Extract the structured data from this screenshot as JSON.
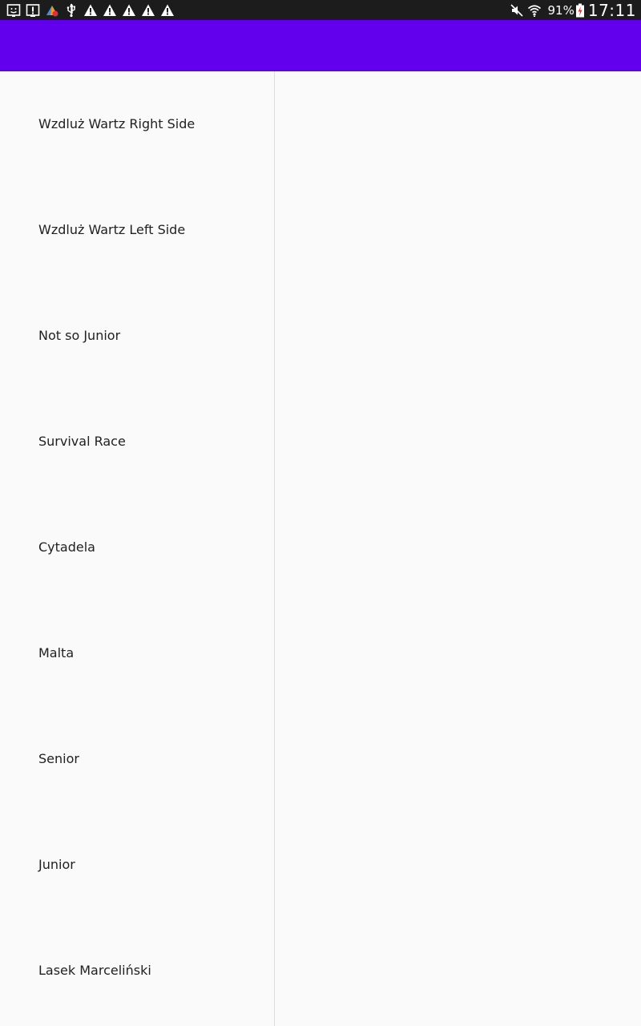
{
  "status_bar": {
    "left_icons": [
      "face-notification-icon",
      "alert-box-icon",
      "weather-app-icon",
      "usb-icon",
      "warning-icon",
      "warning-icon",
      "warning-icon",
      "warning-icon",
      "warning-icon"
    ],
    "right_icons": [
      "mute-icon",
      "wifi-icon",
      "battery-charging-icon"
    ],
    "battery": "91%",
    "time": "17:11"
  },
  "app_bar": {
    "title": "",
    "color": "#6200ee"
  },
  "list": {
    "items": [
      {
        "label": "Wzdluż Wartz Right Side"
      },
      {
        "label": "Wzdluż Wartz Left Side"
      },
      {
        "label": "Not so Junior"
      },
      {
        "label": "Survival Race"
      },
      {
        "label": "Cytadela"
      },
      {
        "label": "Malta"
      },
      {
        "label": "Senior"
      },
      {
        "label": "Junior"
      },
      {
        "label": "Lasek Marceliński"
      }
    ]
  }
}
